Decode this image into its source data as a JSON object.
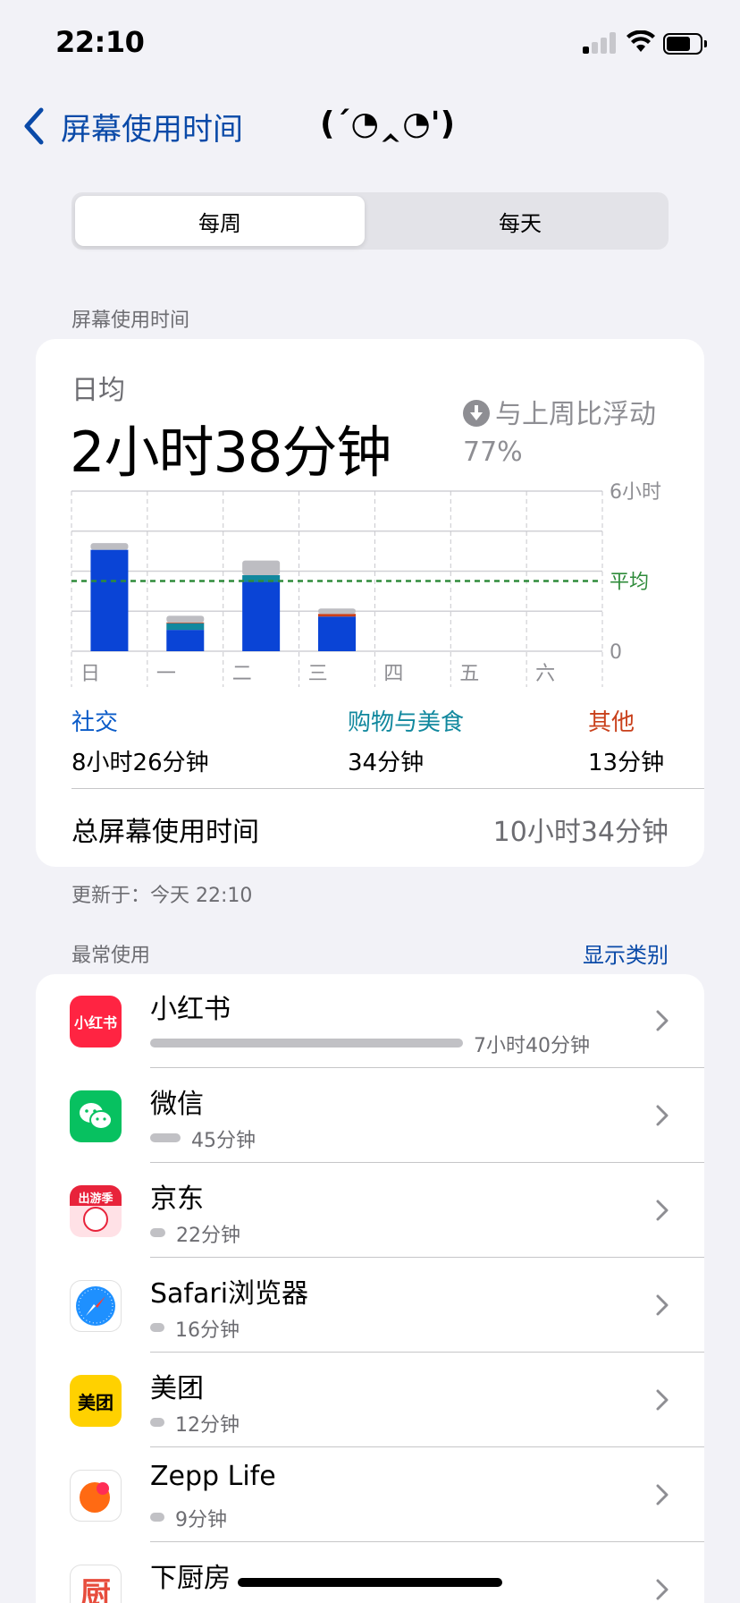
{
  "status_bar": {
    "time": "22:10"
  },
  "nav": {
    "back_label": "屏幕使用时间",
    "title_kaomoji": "(´◔‸◔')"
  },
  "segmented": {
    "weekly": "每周",
    "daily": "每天",
    "selected": "每周"
  },
  "section_title": "屏幕使用时间",
  "summary": {
    "avg_label": "日均",
    "avg_value": "2小时38分钟",
    "trend_text": "与上周比浮动",
    "trend_percent": "77%"
  },
  "chart_data": {
    "type": "bar",
    "categories": [
      "日",
      "一",
      "二",
      "三",
      "四",
      "五",
      "六"
    ],
    "y_unit_label": "6小时",
    "y_zero_label": "0",
    "ylim": [
      0,
      6
    ],
    "average_label": "平均",
    "average": 2.63,
    "series": [
      {
        "name": "社交",
        "color": "#0a44d6",
        "values": [
          3.8,
          0.8,
          2.6,
          1.3,
          0,
          0,
          0
        ]
      },
      {
        "name": "购物与美食",
        "color": "#11889e",
        "values": [
          0,
          0.25,
          0.25,
          0,
          0,
          0,
          0
        ]
      },
      {
        "name": "其他",
        "color": "#c9401b",
        "values": [
          0,
          0.03,
          0,
          0.1,
          0,
          0,
          0
        ]
      },
      {
        "color": "#bdbdc2",
        "values": [
          0.25,
          0.25,
          0.55,
          0.2,
          0,
          0,
          0
        ]
      }
    ]
  },
  "categories_summary": [
    {
      "name": "社交",
      "time": "8小时26分钟",
      "color": "#0a5bc8"
    },
    {
      "name": "购物与美食",
      "time": "34分钟",
      "color": "#11889e"
    },
    {
      "name": "其他",
      "time": "13分钟",
      "color": "#c9401b"
    }
  ],
  "total": {
    "label": "总屏幕使用时间",
    "value": "10小时34分钟"
  },
  "updated": "更新于：今天 22:10",
  "most_used": {
    "title": "最常使用",
    "show_categories": "显示类别"
  },
  "apps": [
    {
      "name": "小红书",
      "time": "7小时40分钟",
      "usage_fraction": 1.0,
      "icon": "xiaohongshu-icon",
      "icon_text": "小红书"
    },
    {
      "name": "微信",
      "time": "45分钟",
      "usage_fraction": 0.098,
      "icon": "wechat-icon"
    },
    {
      "name": "京东",
      "time": "22分钟",
      "usage_fraction": 0.048,
      "icon": "jd-icon",
      "icon_text": "出游季"
    },
    {
      "name": "Safari浏览器",
      "time": "16分钟",
      "usage_fraction": 0.035,
      "icon": "safari-icon"
    },
    {
      "name": "美团",
      "time": "12分钟",
      "usage_fraction": 0.026,
      "icon": "meituan-icon",
      "icon_text": "美团"
    },
    {
      "name": "Zepp Life",
      "time": "9分钟",
      "usage_fraction": 0.02,
      "icon": "zepp-life-icon"
    },
    {
      "name": "下厨房",
      "time": "",
      "usage_fraction": 0,
      "icon": "xiachufang-icon",
      "icon_text": "厨"
    }
  ]
}
